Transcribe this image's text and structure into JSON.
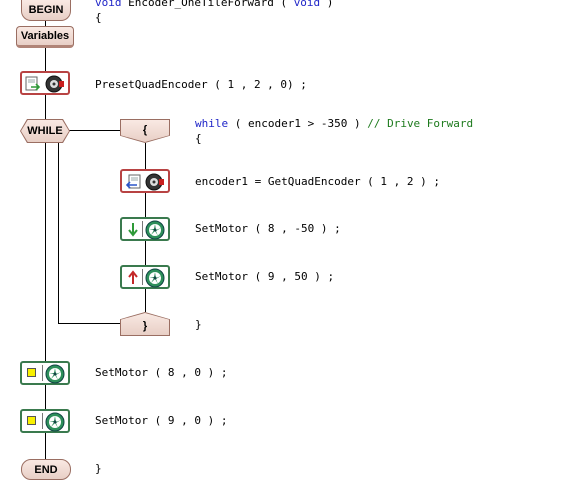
{
  "flowchart": {
    "begin_label": "BEGIN",
    "variables_label": "Variables",
    "while_label": "WHILE",
    "open_brace_label": "{",
    "close_brace_label": "}",
    "end_label": "END",
    "icons": [
      "encoder-preset-icon",
      "encoder-get-icon",
      "motor-icon",
      "arrow-down-icon",
      "arrow-up-icon",
      "stop-square-icon"
    ],
    "colors": {
      "terminal_fill": "#f1ddd6",
      "terminal_border": "#9a6e62",
      "encoder_block_border": "#b84343",
      "motor_block_border": "#3a7a4e",
      "motor_fill": "#2d8f5a",
      "arrow_down": "#2e9a38",
      "arrow_up": "#c42828",
      "stop_square": "#f8f000",
      "keyword": "#1f25c8",
      "comment": "#1d7a1d"
    }
  },
  "code": {
    "signature": {
      "void1": "void",
      "name": " Encoder_OneTileForward ( ",
      "void2": "void",
      "close": " )"
    },
    "open_function_brace": "{",
    "preset_call": "PresetQuadEncoder ( 1 , 2 , 0) ;",
    "while_line": {
      "keyword": "while",
      "condition": " ( encoder1 > -350 ) ",
      "comment": "// Drive Forward"
    },
    "loop_open_brace": "{",
    "get_encoder": "encoder1 = GetQuadEncoder ( 1 , 2 ) ;",
    "motor_8_back": "SetMotor ( 8 , -50 ) ;",
    "motor_9_fwd": "SetMotor ( 9 , 50 ) ;",
    "loop_close_brace": "}",
    "motor_8_stop": "SetMotor ( 8 , 0 ) ;",
    "motor_9_stop": "SetMotor ( 9 , 0 ) ;",
    "close_function_brace": "}"
  }
}
